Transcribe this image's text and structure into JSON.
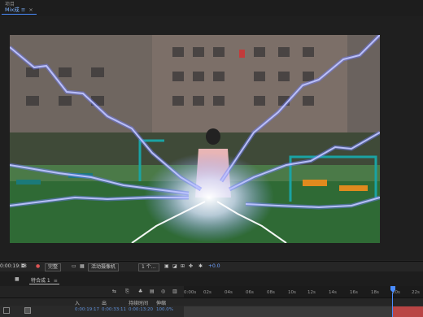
{
  "panel": {
    "title": "项目"
  },
  "composition_tab": {
    "label": "Mix成 ≡",
    "close": "×"
  },
  "viewer_toolbar": {
    "timecode": "0:00:19:18",
    "resolution": "完整",
    "camera": "活动摄像机",
    "views": "1 个…",
    "exposure": "+0.0"
  },
  "timeline": {
    "tab_label": "特合成 1",
    "tab_close": "≡",
    "ruler_ticks": [
      "0:00s",
      "02s",
      "04s",
      "06s",
      "08s",
      "10s",
      "12s",
      "14s",
      "16s",
      "18s",
      "20s",
      "22s"
    ],
    "columns": {
      "in": "入",
      "out": "出",
      "duration": "持续时间",
      "stretch": "伸缩"
    },
    "layer": {
      "in": "0:00:19:17",
      "out": "0:00:33:11",
      "duration": "0:00:13:20",
      "stretch": "100.0%"
    }
  },
  "colors": {
    "accent": "#4a8cff",
    "lightning": "#b9c8ff",
    "work_area": "#b94545"
  }
}
